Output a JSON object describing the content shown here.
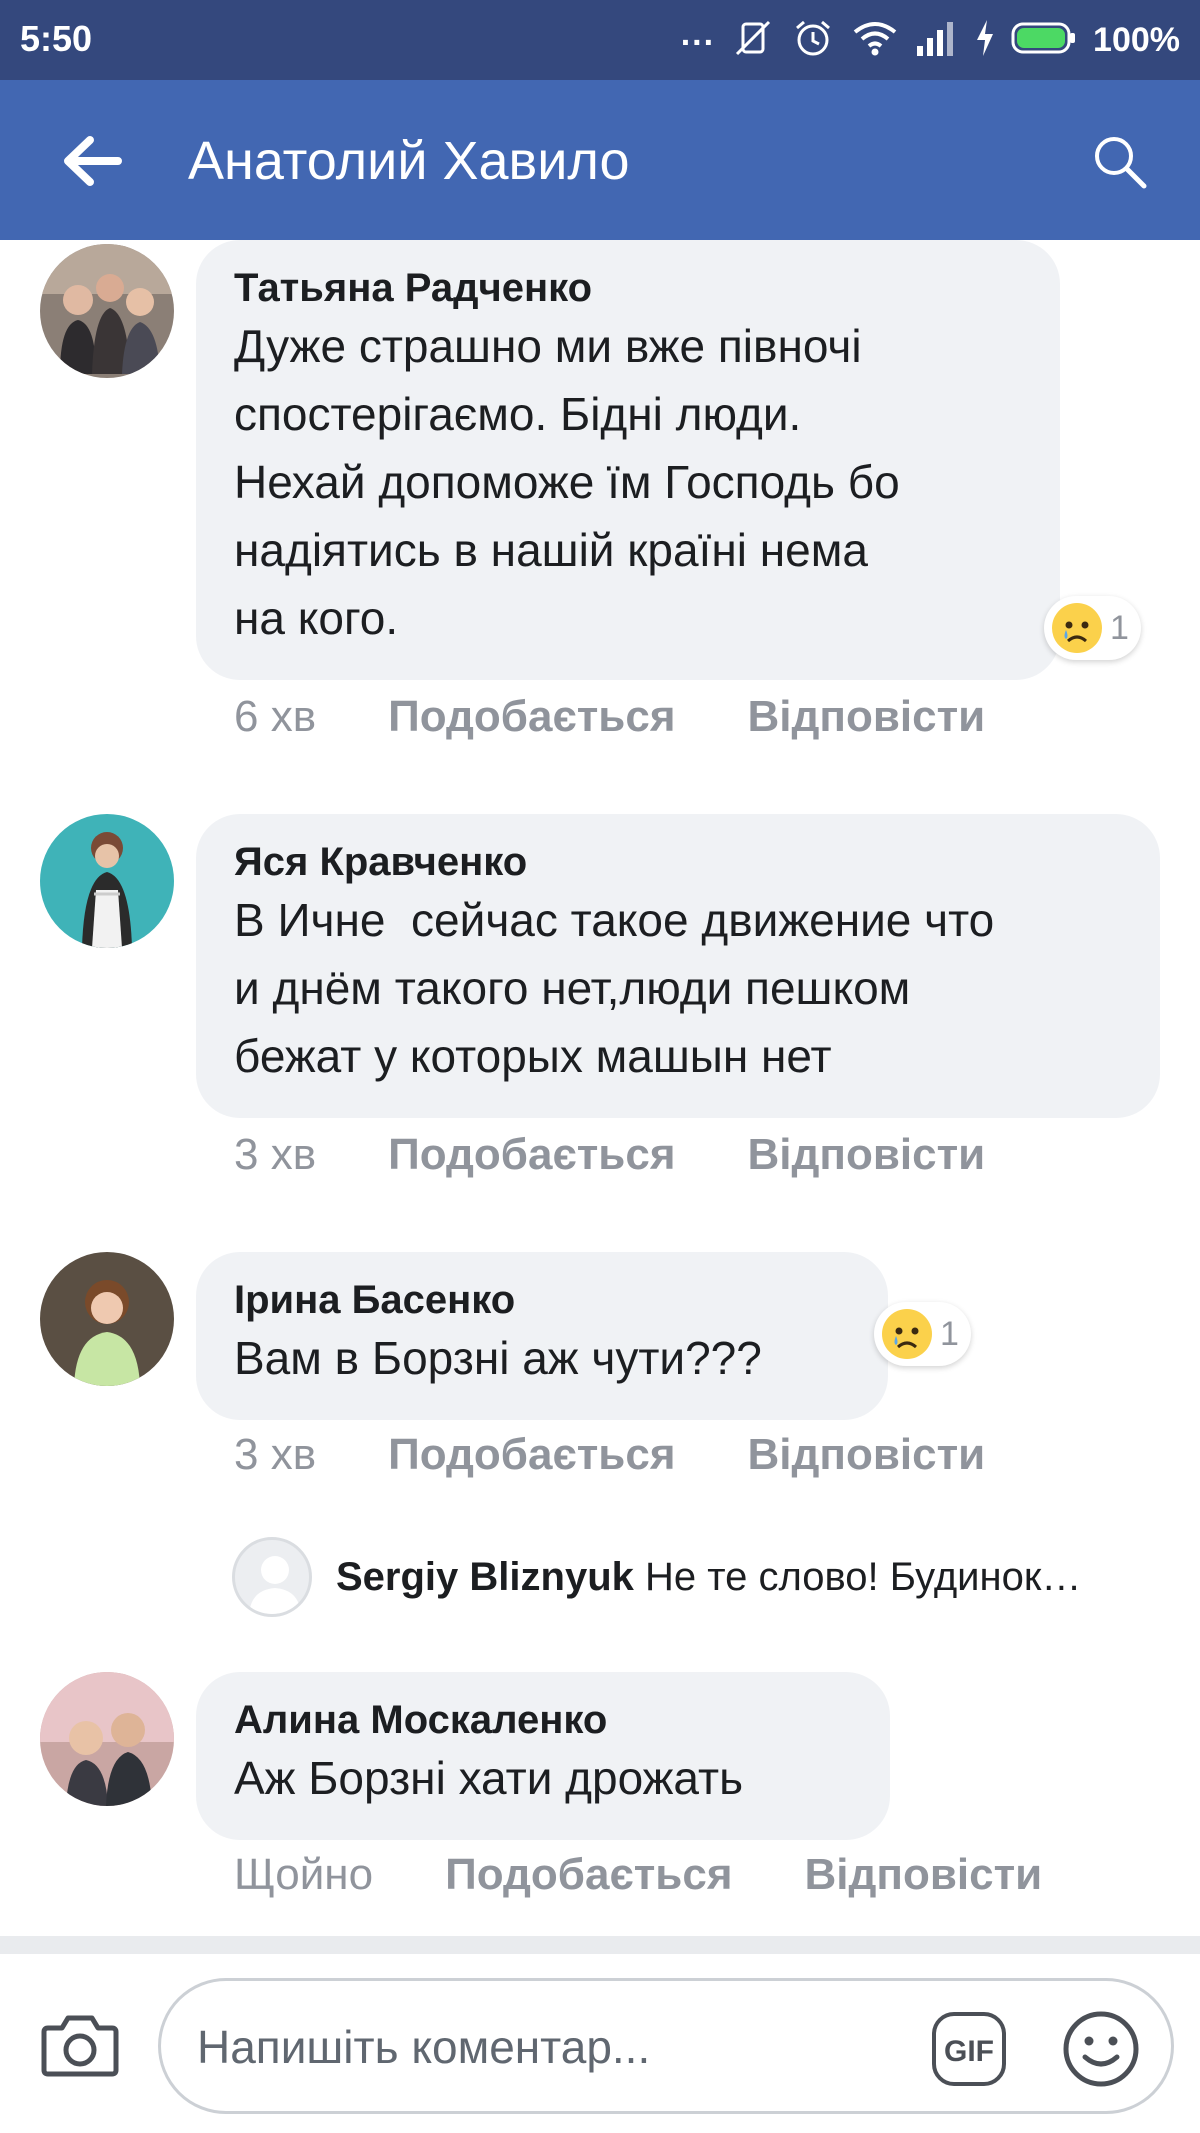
{
  "status_bar": {
    "time": "5:50",
    "dots": "...",
    "battery": "100%"
  },
  "header": {
    "title": "Анатолий Хавило"
  },
  "comments": [
    {
      "author": "Татьяна Радченко",
      "text": "Дуже страшно ми вже півночі\nспостерігаємо. Бідні люди.\nНехай допоможе їм Господь бо\nнадіятись в нашій країні нема\nна кого.",
      "time": "6 хв",
      "like": "Подобається",
      "reply": "Відповісти",
      "reaction": {
        "icon": "sad-emoji",
        "count": "1"
      }
    },
    {
      "author": "Яся Кравченко",
      "text": "В Ичне  сейчас такое движение что\nи днём такого нет,люди пешком\nбежат у которых машын нет",
      "time": "3 хв",
      "like": "Подобається",
      "reply": "Відповісти"
    },
    {
      "author": "Ірина Басенко",
      "text": "Вам в Борзні аж чути???",
      "time": "3 хв",
      "like": "Подобається",
      "reply": "Відповісти",
      "reaction": {
        "icon": "sad-emoji",
        "count": "1"
      }
    },
    {
      "author": "Алина Москаленко",
      "text": "Аж Борзні хати дрожать",
      "time": "Щойно",
      "like": "Подобається",
      "reply": "Відповісти"
    }
  ],
  "reply_preview": {
    "author": "Sergiy Bliznyuk",
    "text": " Не те слово! Будинок…"
  },
  "composer": {
    "placeholder": "Напишіть коментар...",
    "gif_label": "GIF"
  },
  "colors": {
    "status_bar": "#34487d",
    "header": "#4267b2",
    "bubble": "#f0f2f5",
    "meta": "#90949c"
  }
}
